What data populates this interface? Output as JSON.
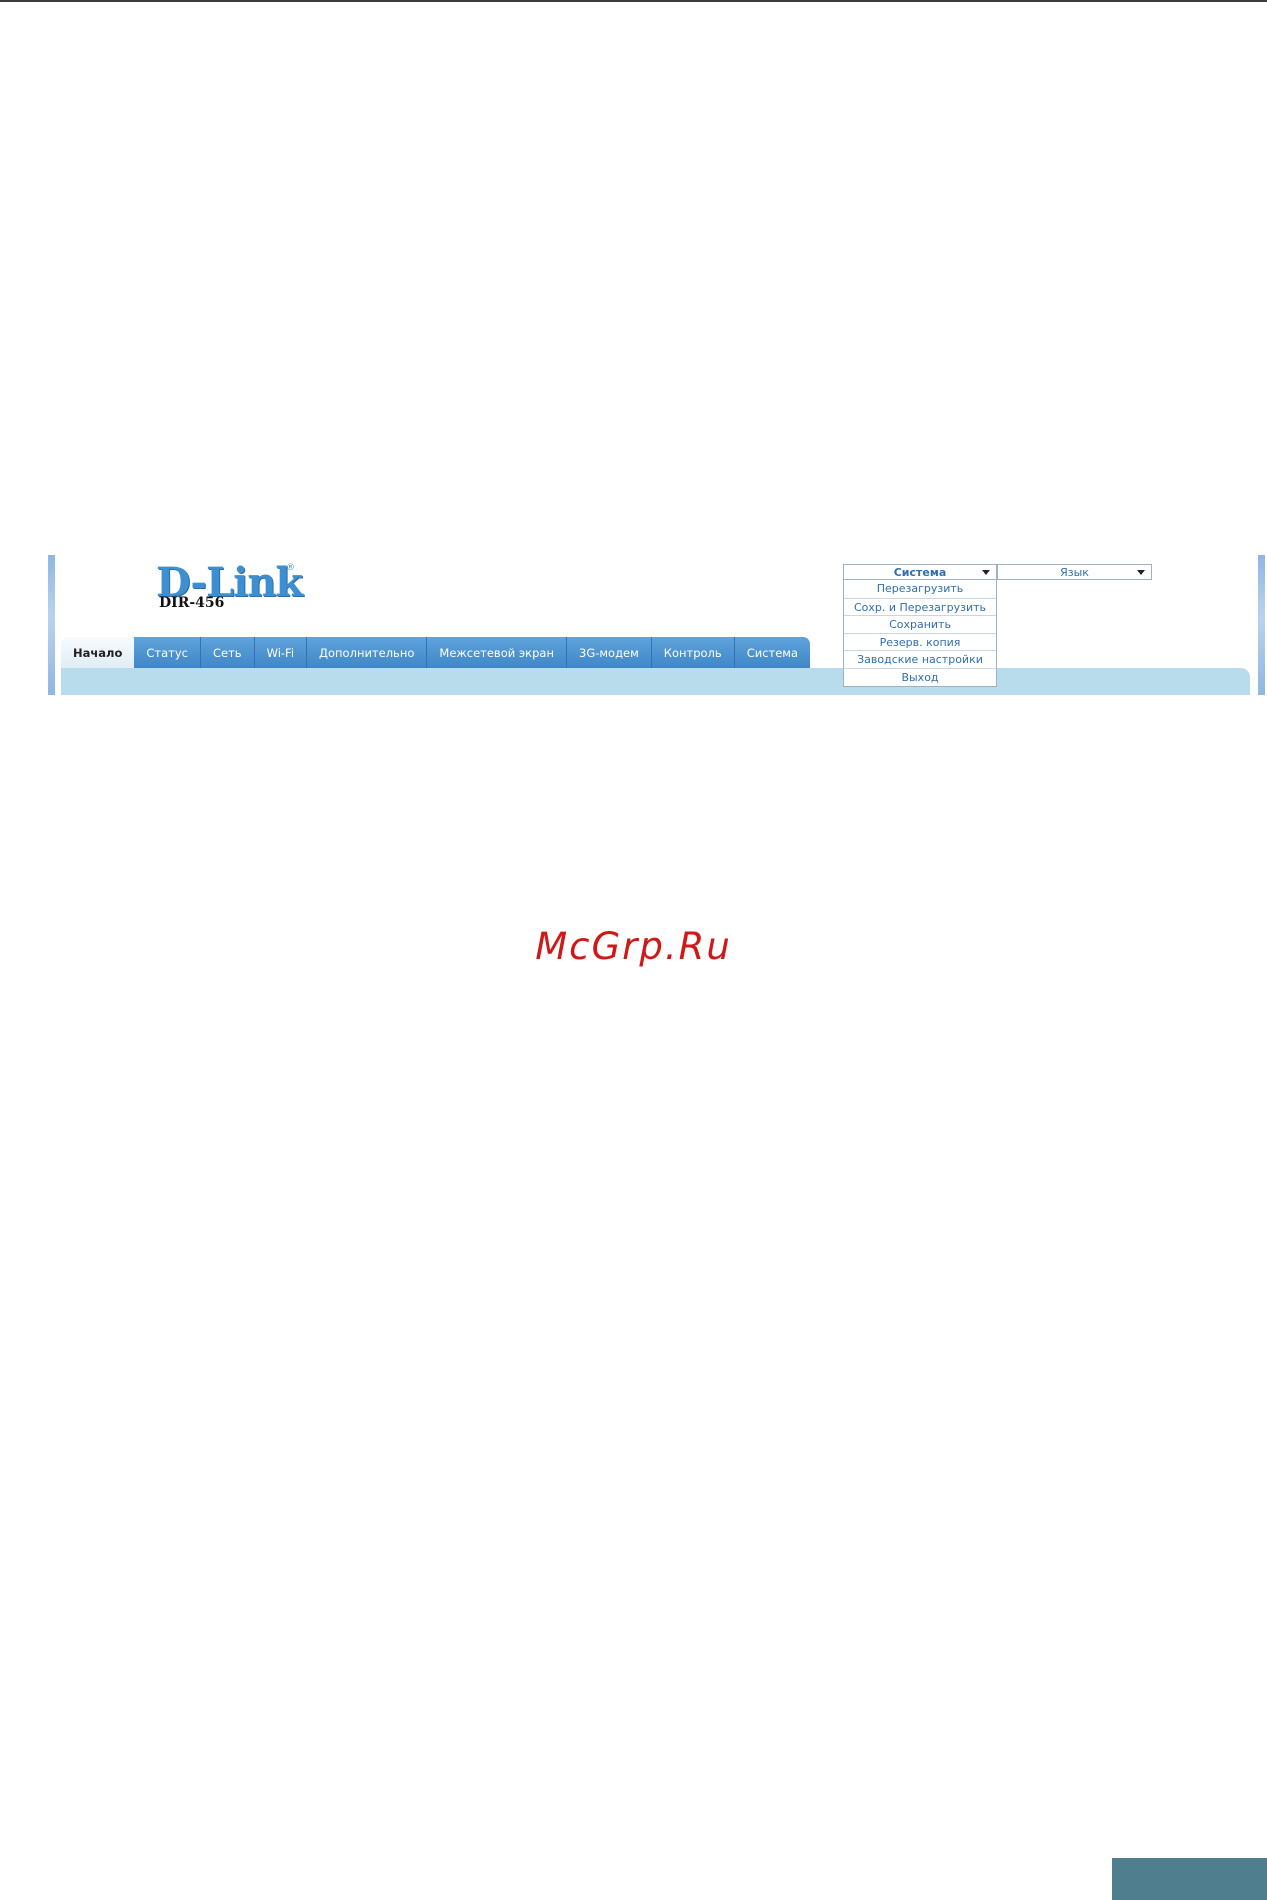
{
  "brand": {
    "logo_text": "D-Link",
    "logo_registered": "®",
    "model": "DIR-456"
  },
  "tabs": [
    {
      "label": "Начало",
      "active": true
    },
    {
      "label": "Статус"
    },
    {
      "label": "Сеть"
    },
    {
      "label": "Wi-Fi"
    },
    {
      "label": "Дополнительно"
    },
    {
      "label": "Межсетевой экран"
    },
    {
      "label": "3G-модем"
    },
    {
      "label": "Контроль"
    },
    {
      "label": "Система"
    }
  ],
  "system_menu": {
    "label": "Система",
    "items": [
      "Перезагрузить",
      "Сохр. и Перезагрузить",
      "Сохранить",
      "Резерв. копия",
      "Заводские настройки",
      "Выход"
    ]
  },
  "language_menu": {
    "label": "Язык"
  },
  "watermark": "McGrp.Ru",
  "colors": {
    "tab_blue": "#3f86c7",
    "content_bar": "#b9dcec",
    "menu_text": "#2f6faf",
    "watermark": "#d01818",
    "page_tab": "#4f7f8e"
  }
}
